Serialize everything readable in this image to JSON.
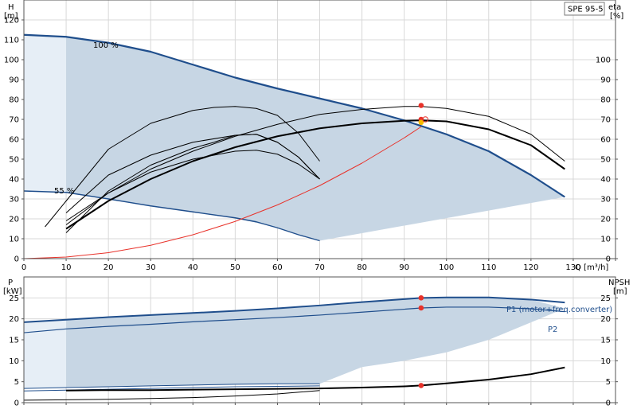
{
  "colors": {
    "curve_blue": "#1f4e8c",
    "fill_blue": "#c7d6e4",
    "fill_light": "#e6eef6",
    "system_red": "#e8322a",
    "grid": "#d8d8d8"
  },
  "chart_data": [
    {
      "type": "line",
      "title": "",
      "badge": "SPE 95-5",
      "y_left_label": [
        "H",
        "[m]"
      ],
      "y_right_label": [
        "eta",
        "[%]"
      ],
      "xlabel": "Q [m³/h]",
      "xlim": [
        0,
        140
      ],
      "ylim": [
        0,
        130
      ],
      "x_ticks": [
        0,
        10,
        20,
        30,
        40,
        50,
        60,
        70,
        80,
        90,
        100,
        110,
        120,
        130
      ],
      "y_left_ticks": [
        0,
        10,
        20,
        30,
        40,
        50,
        60,
        70,
        80,
        90,
        100,
        110,
        120
      ],
      "y_right_ticks": [
        0,
        10,
        20,
        30,
        40,
        50,
        60,
        70,
        80,
        90,
        100
      ],
      "grid": true,
      "annotations": [
        {
          "text": "100 %",
          "x": 17,
          "y": 114
        },
        {
          "text": "55 %",
          "x": 7,
          "y": 36
        }
      ],
      "series": [
        {
          "role": "max_speed",
          "color": "#1f4e8c",
          "width": 2.2,
          "x": [
            0,
            10,
            20,
            30,
            40,
            50,
            60,
            70,
            80,
            90,
            100,
            110,
            120,
            128
          ],
          "y": [
            112.5,
            111.5,
            108.5,
            104,
            97.5,
            91,
            85.5,
            80.5,
            75.5,
            69.5,
            62.5,
            54,
            42,
            31
          ]
        },
        {
          "role": "min_speed",
          "color": "#1f4e8c",
          "width": 1.4,
          "x": [
            0,
            10,
            20,
            30,
            40,
            50,
            55,
            60,
            65,
            70
          ],
          "y": [
            34,
            33.3,
            30,
            26.5,
            23.5,
            20.5,
            18.5,
            15.5,
            12,
            9
          ]
        },
        {
          "role": "system_curve",
          "color": "#e8322a",
          "width": 1,
          "x": [
            0,
            10,
            20,
            30,
            40,
            50,
            60,
            70,
            80,
            90,
            94
          ],
          "y": [
            0,
            0.8,
            3,
            6.7,
            12,
            18.7,
            27,
            36.7,
            48,
            60.7,
            66.3
          ]
        },
        {
          "role": "eta_total_max",
          "color": "#000000",
          "width": 2,
          "x": [
            10,
            20,
            30,
            40,
            50,
            60,
            70,
            80,
            90,
            94,
            100,
            110,
            120,
            128
          ],
          "y": [
            15,
            29,
            40,
            49,
            56,
            61.5,
            65.5,
            68,
            69.3,
            69.5,
            69,
            65,
            57,
            45
          ]
        },
        {
          "role": "eta_pump_max",
          "color": "#000000",
          "width": 1,
          "x": [
            10,
            20,
            30,
            40,
            50,
            60,
            70,
            80,
            90,
            94,
            100,
            110,
            120,
            128
          ],
          "y": [
            19,
            33,
            45,
            54,
            61.5,
            67.5,
            72.5,
            75,
            76.5,
            76.5,
            75.5,
            71.5,
            62.5,
            49
          ]
        },
        {
          "role": "eta_total_min",
          "color": "#000000",
          "width": 1,
          "x": [
            10,
            20,
            30,
            40,
            50,
            55,
            60,
            65,
            70
          ],
          "y": [
            17,
            33,
            43.5,
            50,
            54,
            54.5,
            52.5,
            47.5,
            40
          ]
        },
        {
          "role": "eta_pump_min",
          "color": "#000000",
          "width": 1,
          "x": [
            10,
            20,
            30,
            40,
            50,
            55,
            60,
            65,
            70
          ],
          "y": [
            23,
            42,
            52,
            58.5,
            62,
            62.5,
            58.5,
            51,
            40
          ]
        },
        {
          "role": "eta_total_mid",
          "color": "#000000",
          "width": 1,
          "x": [
            10,
            20,
            30,
            40,
            45,
            50,
            55,
            60,
            65,
            70
          ],
          "y": [
            13,
            34,
            47,
            55.5,
            58.5,
            62,
            62.5,
            58.5,
            51,
            40
          ]
        },
        {
          "role": "eta_pump_mid",
          "color": "#000000",
          "width": 1,
          "x": [
            5,
            10,
            20,
            30,
            40,
            45,
            50,
            55,
            60,
            65,
            70
          ],
          "y": [
            16,
            29,
            55,
            68,
            74.5,
            76,
            76.5,
            75.5,
            72,
            63,
            49
          ]
        }
      ],
      "envelope": {
        "x": [
          10,
          20,
          30,
          40,
          50,
          60,
          70,
          80,
          90,
          100,
          110,
          120,
          128,
          70,
          60,
          50,
          40,
          30,
          20,
          10
        ],
        "y": [
          111.5,
          108.5,
          104,
          97.5,
          91,
          85.5,
          80.5,
          75.5,
          69.5,
          62.5,
          54,
          42,
          31,
          9,
          15.5,
          20.5,
          23.5,
          26.5,
          30,
          33.3
        ]
      },
      "light_envelope": {
        "x": [
          0,
          10,
          10,
          0
        ],
        "y": [
          112.5,
          111.5,
          33.3,
          34
        ]
      },
      "region_lower": {
        "x": [
          70,
          128,
          128,
          70
        ],
        "y": [
          9,
          31,
          31,
          9
        ]
      },
      "duty_points": [
        {
          "x": 94,
          "y": 77,
          "color": "#e8322a",
          "kind": "dot"
        },
        {
          "x": 94,
          "y": 70,
          "color": "#e8322a",
          "kind": "dot"
        },
        {
          "x": 94,
          "y": 68.5,
          "color": "#f5b800",
          "kind": "dot"
        },
        {
          "x": 95,
          "y": 70,
          "color": "#e8322a",
          "kind": "ring"
        }
      ]
    },
    {
      "type": "line",
      "title": "",
      "y_left_label": [
        "P",
        "[kW]"
      ],
      "y_right_label": [
        "NPSH",
        "[m]"
      ],
      "xlim": [
        0,
        140
      ],
      "ylim": [
        0,
        30
      ],
      "y_left_ticks": [
        0,
        5,
        10,
        15,
        20,
        25
      ],
      "y_right_ticks": [
        0,
        5,
        10,
        15,
        20,
        25
      ],
      "grid": true,
      "series": [
        {
          "role": "p1_max",
          "name": "P1 (motor+freq.converter)",
          "color": "#1f4e8c",
          "width": 2,
          "x": [
            0,
            10,
            20,
            30,
            40,
            50,
            60,
            70,
            80,
            90,
            94,
            100,
            110,
            120,
            128
          ],
          "y": [
            19.2,
            19.8,
            20.4,
            20.9,
            21.4,
            21.9,
            22.5,
            23.2,
            24,
            24.7,
            25,
            25.1,
            25.1,
            24.6,
            23.9
          ]
        },
        {
          "role": "p2_max",
          "name": "P2",
          "color": "#1f4e8c",
          "width": 1.2,
          "x": [
            0,
            10,
            20,
            30,
            40,
            50,
            60,
            70,
            80,
            90,
            94,
            100,
            110,
            120,
            128
          ],
          "y": [
            16.7,
            17.6,
            18.2,
            18.7,
            19.3,
            19.8,
            20.3,
            20.9,
            21.6,
            22.3,
            22.6,
            22.8,
            22.8,
            22.4,
            21.7
          ]
        },
        {
          "role": "p1_min",
          "color": "#1f4e8c",
          "width": 1,
          "x": [
            0,
            10,
            20,
            30,
            40,
            50,
            60,
            70
          ],
          "y": [
            3.4,
            3.6,
            3.8,
            4.0,
            4.2,
            4.4,
            4.5,
            4.5
          ]
        },
        {
          "role": "p2_min",
          "color": "#1f4e8c",
          "width": 1,
          "x": [
            0,
            10,
            20,
            30,
            40,
            50,
            60,
            70
          ],
          "y": [
            2.8,
            3.0,
            3.2,
            3.4,
            3.6,
            3.8,
            3.9,
            4.0
          ]
        },
        {
          "role": "npsh",
          "color": "#000000",
          "width": 2,
          "x": [
            10,
            20,
            30,
            40,
            50,
            60,
            70,
            80,
            90,
            94,
            100,
            110,
            120,
            128
          ],
          "y": [
            2.9,
            3.0,
            3.0,
            3.1,
            3.2,
            3.3,
            3.4,
            3.6,
            3.9,
            4.1,
            4.6,
            5.5,
            6.8,
            8.4
          ]
        },
        {
          "role": "npsh_min",
          "color": "#000000",
          "width": 1,
          "x": [
            0,
            10,
            20,
            30,
            40,
            50,
            60,
            70
          ],
          "y": [
            0.6,
            0.7,
            0.8,
            1.0,
            1.2,
            1.6,
            2.1,
            2.9
          ]
        }
      ],
      "envelope": {
        "x": [
          10,
          20,
          30,
          40,
          50,
          60,
          70,
          80,
          90,
          100,
          110,
          120,
          128,
          110,
          100,
          90,
          80,
          70,
          60,
          50,
          40,
          30,
          20,
          10
        ],
        "y": [
          19.8,
          20.4,
          20.9,
          21.4,
          21.9,
          22.5,
          23.2,
          24,
          24.7,
          25.1,
          25.1,
          24.6,
          22.5,
          15,
          12,
          10,
          8.5,
          4.5,
          4.5,
          4.4,
          4.2,
          4.0,
          3.8,
          3.6
        ]
      },
      "light_envelope": {
        "x": [
          0,
          10,
          10,
          0
        ],
        "y": [
          19.2,
          19.8,
          3.6,
          3.4
        ]
      },
      "duty_points": [
        {
          "x": 94,
          "y": 25,
          "color": "#e8322a",
          "kind": "dot"
        },
        {
          "x": 94,
          "y": 22.6,
          "color": "#e8322a",
          "kind": "dot"
        },
        {
          "x": 94,
          "y": 4.1,
          "color": "#e8322a",
          "kind": "dot"
        }
      ]
    }
  ]
}
